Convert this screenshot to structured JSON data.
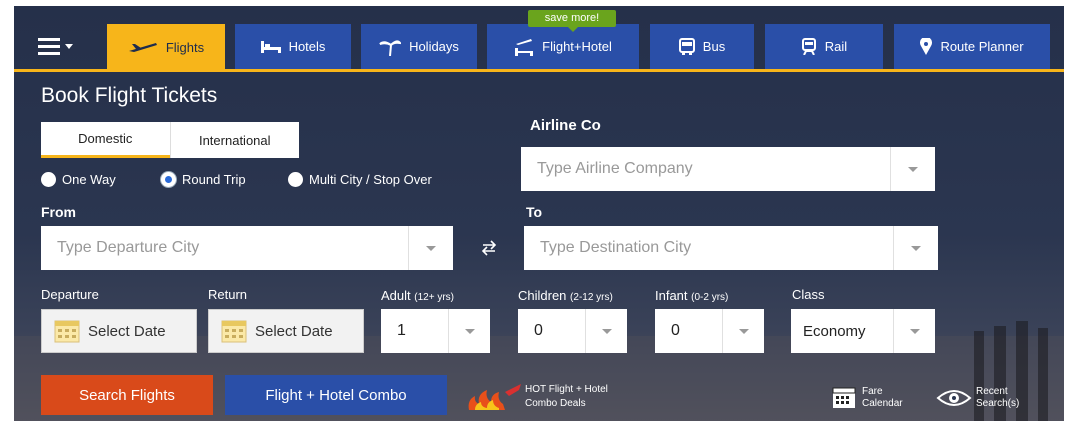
{
  "nav": {
    "items": [
      {
        "label": "Flights",
        "icon": "plane-icon",
        "active": true
      },
      {
        "label": "Hotels",
        "icon": "bed-icon",
        "active": false
      },
      {
        "label": "Holidays",
        "icon": "palm-tree-icon",
        "active": false
      },
      {
        "label": "Flight+Hotel",
        "icon": "flight-hotel-icon",
        "active": false
      },
      {
        "label": "Bus",
        "icon": "bus-icon",
        "active": false
      },
      {
        "label": "Rail",
        "icon": "train-icon",
        "active": false
      },
      {
        "label": "Route Planner",
        "icon": "location-pin-icon",
        "active": false
      }
    ],
    "badge": "save more!"
  },
  "form": {
    "title": "Book Flight Tickets",
    "tabs": [
      {
        "label": "Domestic",
        "active": true
      },
      {
        "label": "International",
        "active": false
      }
    ],
    "trip_types": [
      {
        "label": "One Way",
        "checked": false
      },
      {
        "label": "Round Trip",
        "checked": true
      },
      {
        "label": "Multi City / Stop Over",
        "checked": false
      }
    ],
    "airline": {
      "label": "Airline Co",
      "placeholder": "Type Airline Company"
    },
    "from": {
      "label": "From",
      "placeholder": "Type Departure City"
    },
    "to": {
      "label": "To",
      "placeholder": "Type Destination City"
    },
    "swap_icon": "swap-arrows-icon",
    "departure": {
      "label": "Departure",
      "value": "Select Date"
    },
    "return": {
      "label": "Return",
      "value": "Select Date"
    },
    "adult": {
      "label": "Adult",
      "hint": "(12+ yrs)",
      "value": "1"
    },
    "children": {
      "label": "Children",
      "hint": "(2-12 yrs)",
      "value": "0"
    },
    "infant": {
      "label": "Infant",
      "hint": "(0-2 yrs)",
      "value": "0"
    },
    "class": {
      "label": "Class",
      "value": "Economy"
    }
  },
  "actions": {
    "search_label": "Search Flights",
    "combo_label": "Flight + Hotel Combo",
    "deals_line1": "HOT Flight + Hotel",
    "deals_line2": "Combo Deals",
    "fare_line1": "Fare",
    "fare_line2": "Calendar",
    "recent_line1": "Recent",
    "recent_line2": "Search(s)"
  },
  "colors": {
    "accent": "#f7b51a",
    "nav_blue": "#2a4fa8",
    "search": "#d94a1a",
    "badge": "#6aa41d"
  }
}
